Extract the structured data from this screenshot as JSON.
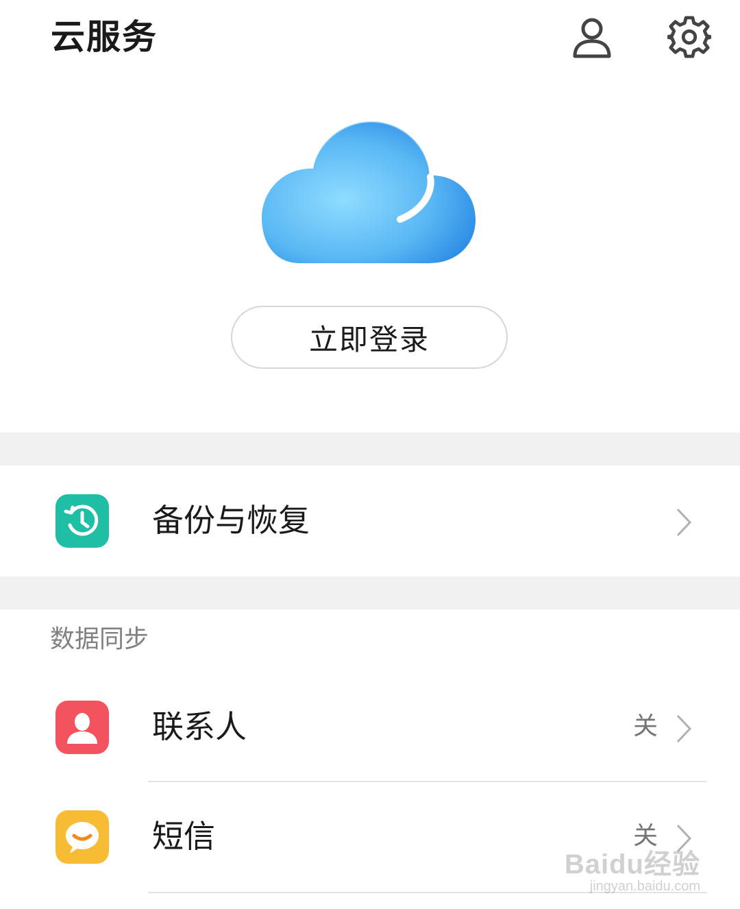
{
  "header": {
    "title": "云服务",
    "user_icon": "person-icon",
    "settings_icon": "gear-icon"
  },
  "hero": {
    "cloud_icon": "cloud-icon",
    "login_label": "立即登录"
  },
  "backup": {
    "label": "备份与恢复",
    "icon": "history-clock-icon",
    "icon_color": "#1fbfa6"
  },
  "sync": {
    "heading": "数据同步",
    "items": [
      {
        "label": "联系人",
        "value": "关",
        "icon": "contact-person-icon",
        "icon_color": "#f3535f"
      },
      {
        "label": "短信",
        "value": "关",
        "icon": "message-bubble-icon",
        "icon_color": "#f7bc34"
      }
    ]
  },
  "watermark": {
    "line1": "Baidu经验",
    "line2": "jingyan.baidu.com"
  }
}
